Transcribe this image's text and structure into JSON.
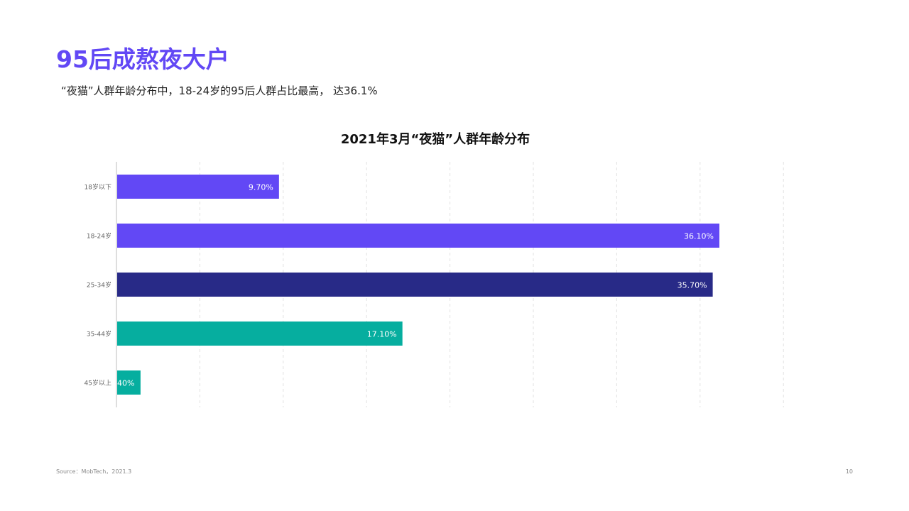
{
  "header": {
    "title": "95后成熬夜大户",
    "subtitle": "“夜猫”人群年龄分布中，18-24岁的95后人群占比最高， 达36.1%"
  },
  "chart_data": {
    "type": "bar",
    "orientation": "horizontal",
    "title": "2021年3月“夜猫”人群年龄分布",
    "xlabel": "",
    "ylabel": "",
    "xlim": [
      0,
      40
    ],
    "grid": "vertical-dashed",
    "categories": [
      "18岁以下",
      "18-24岁",
      "25-34岁",
      "35-44岁",
      "45岁以上"
    ],
    "values": [
      9.7,
      36.1,
      35.7,
      17.1,
      1.4
    ],
    "data_labels": [
      "9.70%",
      "36.10%",
      "35.70%",
      "17.10%",
      "40%"
    ],
    "colors": [
      "#6248f5",
      "#6248f5",
      "#282a87",
      "#06ae9f",
      "#06ae9f"
    ]
  },
  "footer": {
    "source": "Source：MobTech，2021.3",
    "page_number": "10"
  }
}
